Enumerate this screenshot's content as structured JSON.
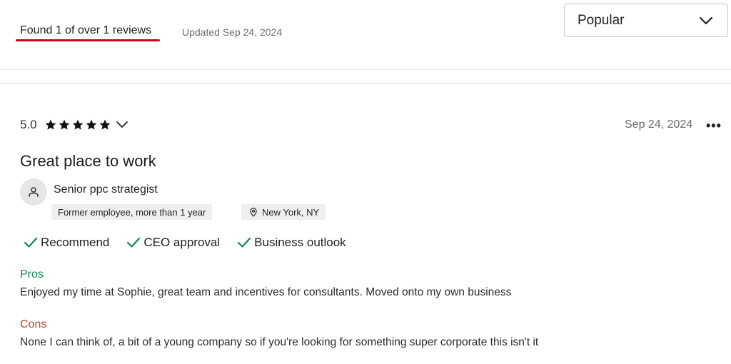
{
  "header": {
    "found_text": "Found 1 of over 1 reviews",
    "updated_text": "Updated Sep 24, 2024",
    "sort": {
      "selected": "Popular",
      "icon": "chevron-down-icon"
    },
    "accent_underline_color": "#d0021b"
  },
  "review": {
    "rating": "5.0",
    "stars": 5,
    "date": "Sep 24, 2024",
    "more_icon": "•••",
    "title": "Great place to work",
    "author": {
      "icon": "person-icon",
      "job_title": "Senior ppc strategist",
      "employment": "Former employee, more than 1 year",
      "location": "New York, NY"
    },
    "badges": [
      {
        "label": "Recommend",
        "icon": "check-icon"
      },
      {
        "label": "CEO approval",
        "icon": "check-icon"
      },
      {
        "label": "Business outlook",
        "icon": "check-icon"
      }
    ],
    "pros_label": "Pros",
    "pros_text": "Enjoyed my time at Sophie, great team and incentives for consultants. Moved onto my own business",
    "cons_label": "Cons",
    "cons_text": "None I can think of, a bit of a young company so if you're looking for something super corporate this isn't it",
    "colors": {
      "pros": "#0f8a4f",
      "cons": "#b5472d",
      "check": "#0f8a4f"
    }
  }
}
